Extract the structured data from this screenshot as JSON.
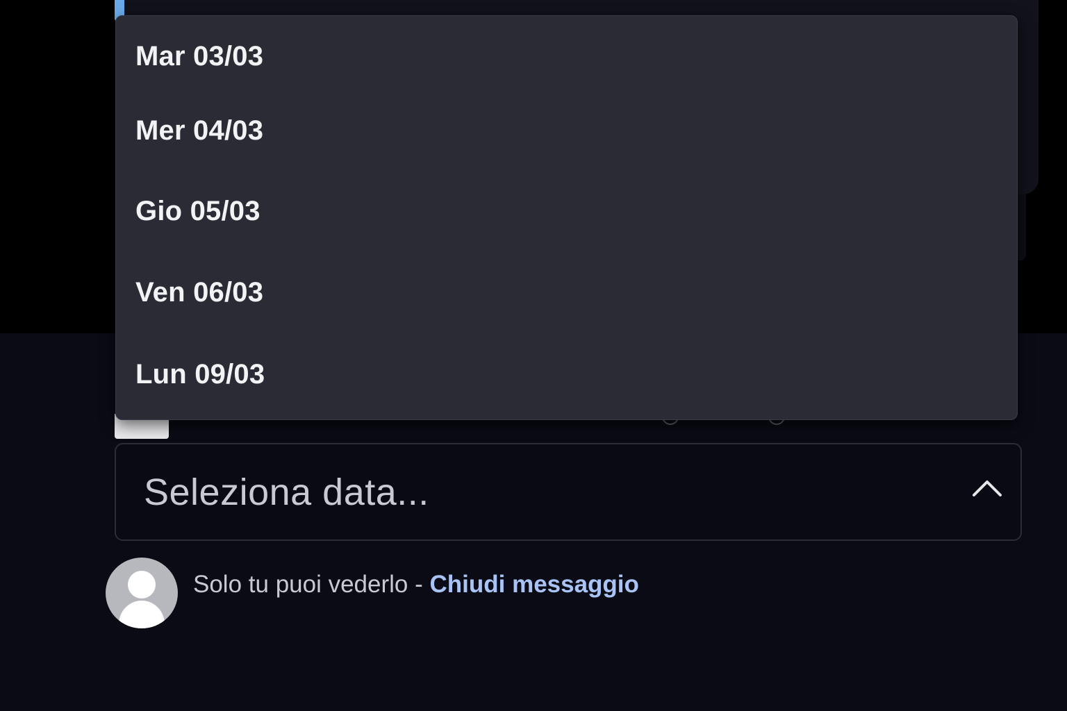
{
  "dropdown": {
    "options": [
      "Mar 03/03",
      "Mer 04/03",
      "Gio 05/03",
      "Ven 06/03",
      "Lun 09/03"
    ]
  },
  "select": {
    "placeholder": "Seleziona data...",
    "expanded": true,
    "chevron_icon": "chevron-up-icon"
  },
  "ephemeral": {
    "notice": "Solo tu puoi vederlo - ",
    "dismiss_label": "Chiudi messaggio",
    "avatar_icon": "default-user-avatar-icon"
  },
  "colors": {
    "menu_bg": "#2a2b35",
    "page_bg": "#0a0b14",
    "link": "#a8c3f4",
    "accent": "#6aa9e8"
  }
}
